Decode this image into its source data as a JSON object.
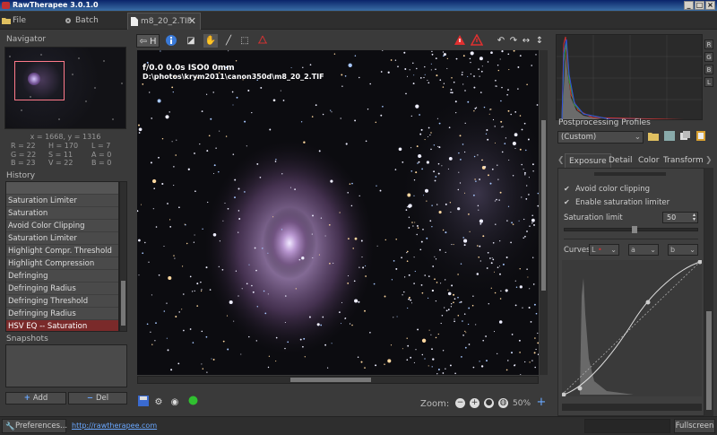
{
  "window": {
    "title": "RawTherapee 3.0.1.0"
  },
  "tabs": [
    {
      "label": "File Browser"
    },
    {
      "label": "Batch Queue"
    },
    {
      "label": "m8_20_2.TIF"
    }
  ],
  "navigator": {
    "title": "Navigator",
    "coords": "x = 1668, y = 1316",
    "values": [
      "R = 22",
      "H = 170",
      "L = 7",
      "G = 22",
      "S = 11",
      "A = 0",
      "B = 23",
      "V = 22",
      "B = 0"
    ]
  },
  "history": {
    "title": "History",
    "items": [
      "Saturation Limiter",
      "Saturation",
      "Avoid Color Clipping",
      "Saturation Limiter",
      "Highlight Compr. Threshold",
      "Highlight Compression",
      "Defringing",
      "Defringing Radius",
      "Defringing Threshold",
      "Defringing Radius",
      "HSV EQ -- Saturation"
    ],
    "selected_index": 10
  },
  "snapshots": {
    "title": "Snapshots",
    "add_label": "Add",
    "del_label": "Del"
  },
  "image": {
    "exif_line1": "f/0.0  0.0s  ISO0  0mm",
    "exif_line2": "D:\\photos\\krym2011\\canon350d\\m8_20_2.TIF"
  },
  "toolbar": {
    "hand_label": "H"
  },
  "zoom": {
    "label": "Zoom:",
    "percent": "50%"
  },
  "histogram": {
    "channels": [
      "R",
      "G",
      "B",
      "L"
    ]
  },
  "profiles": {
    "title": "Postprocessing Profiles",
    "selected": "(Custom)"
  },
  "tool_tabs": [
    "Exposure",
    "Detail",
    "Color",
    "Transform"
  ],
  "exposure": {
    "avoid_clipping_label": "Avoid color clipping",
    "avoid_clipping": true,
    "sat_limiter_label": "Enable saturation limiter",
    "sat_limiter": true,
    "sat_limit_label": "Saturation limit",
    "sat_limit_value": "50",
    "sat_limit_fraction": 0.5
  },
  "curves": {
    "label": "Curves:",
    "l_box": "L",
    "a_box": "a",
    "b_box": "b"
  },
  "statusbar": {
    "preferences_label": "Preferences...",
    "link": "http://rawtherapee.com",
    "fullscreen_label": "Fullscreen"
  },
  "colors": {
    "accent_blue": "#6aa8ff",
    "selected_history": "#7a2a2a",
    "navigator_rect": "#ff7a8a"
  }
}
